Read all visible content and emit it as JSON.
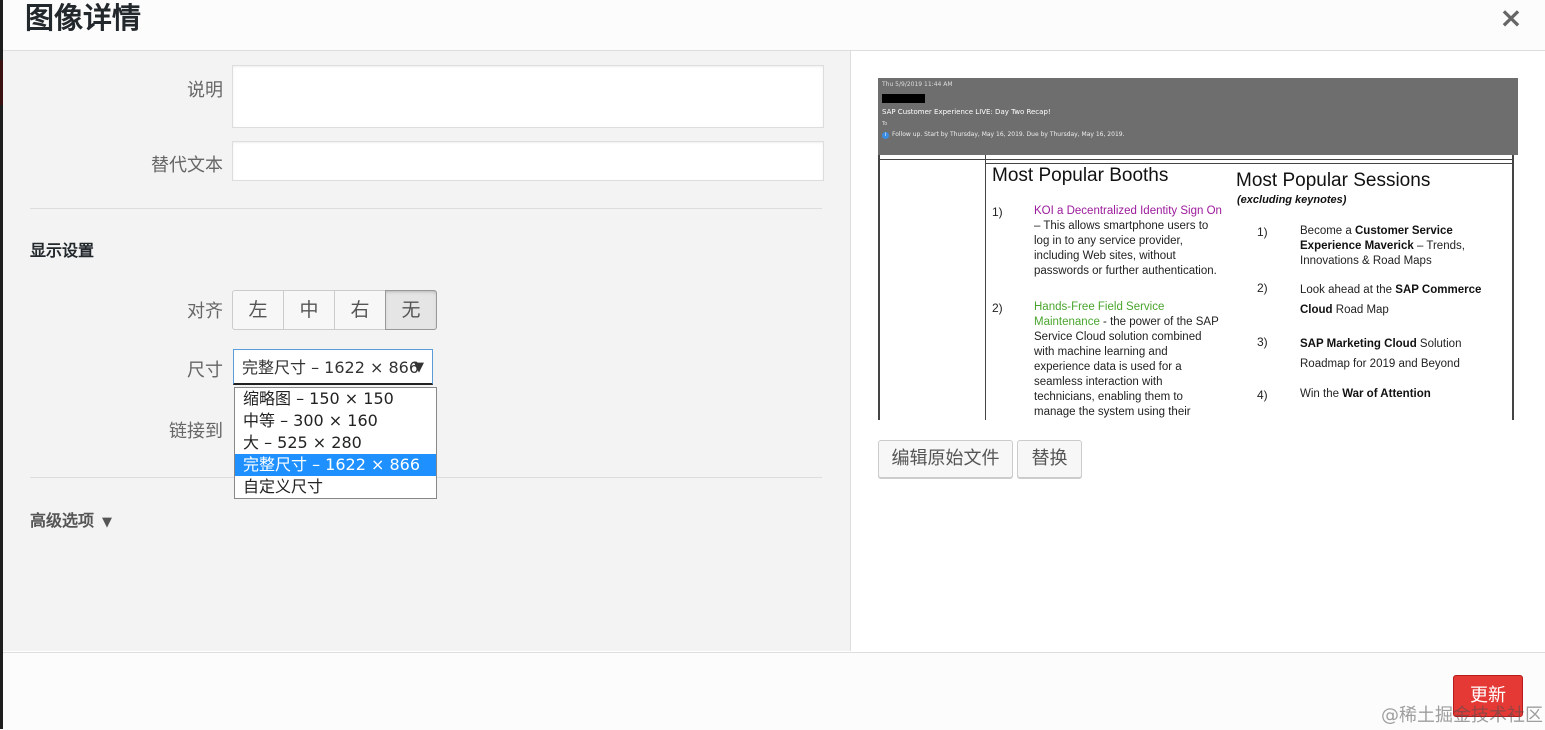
{
  "dialog": {
    "title": "图像详情",
    "close_symbol": "×"
  },
  "fields": {
    "caption_label": "说明",
    "alt_label": "替代文本",
    "caption_value": "",
    "alt_value": ""
  },
  "display_settings": {
    "heading": "显示设置",
    "align_label": "对齐",
    "align_options": [
      "左",
      "中",
      "右",
      "无"
    ],
    "align_selected": "无",
    "size_label": "尺寸",
    "size_selected": "完整尺寸 – 1622 × 866",
    "size_options": [
      "缩略图 – 150 × 150",
      "中等 – 300 × 160",
      "大 – 525 × 280",
      "完整尺寸 – 1622 × 866",
      "自定义尺寸"
    ],
    "link_label": "链接到",
    "dropdown_arrow": "▼"
  },
  "advanced": {
    "label": "高级选项",
    "arrow": "▼"
  },
  "preview": {
    "email_date": "Thu 5/9/2019 11:44 AM",
    "email_subject": "SAP Customer Experience LIVE: Day Two Recap!",
    "email_to": "To",
    "email_followup": "Follow up.  Start by Thursday, May 16, 2019.  Due by Thursday, May 16, 2019.",
    "info_icon": "i",
    "col1_title": "Most Popular Booths",
    "col1_items": [
      {
        "num": "1)",
        "highlight": "KOI a Decentralized Identity Sign On",
        "text": " – This allows smartphone users to log in to any service provider, including Web sites, without passwords or further authentication."
      },
      {
        "num": "2)",
        "highlight": "Hands-Free Field Service Maintenance",
        "text": "  - the power of the SAP Service Cloud solution combined with machine learning and experience data is used for a seamless interaction with technicians, enabling them to manage the system using their"
      }
    ],
    "col2_title": "Most Popular Sessions",
    "col2_subtitle": "(excluding keynotes)",
    "col2_items": [
      {
        "num": "1)",
        "pre": "Become a ",
        "bold": "Customer Service Experience Maverick",
        "post": " – Trends, Innovations & Road Maps"
      },
      {
        "num": "2)",
        "pre": "Look ahead at the ",
        "bold": "SAP Commerce Cloud",
        "post": " Road Map"
      },
      {
        "num": "3)",
        "pre": "",
        "bold": "SAP Marketing Cloud",
        "post": " Solution Roadmap for 2019 and Beyond"
      },
      {
        "num": "4)",
        "pre": "Win the ",
        "bold": "War of Attention",
        "post": ""
      }
    ]
  },
  "actions": {
    "edit_original": "编辑原始文件",
    "replace": "替换",
    "update": "更新"
  },
  "watermark": "@稀土掘金技术社区"
}
